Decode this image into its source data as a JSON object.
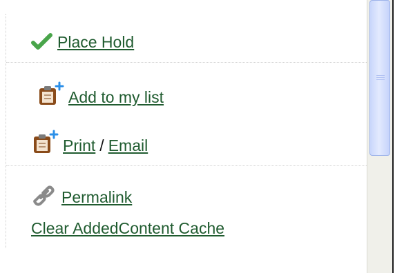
{
  "actions": {
    "place_hold": {
      "label": "Place Hold",
      "icon": "checkmark-icon"
    },
    "add_to_list": {
      "label": "Add to my list",
      "icon": "clipboard-add-icon"
    },
    "print": {
      "label": "Print",
      "icon": "clipboard-add-icon"
    },
    "separator": "/",
    "email": {
      "label": "Email"
    },
    "permalink": {
      "label": "Permalink",
      "icon": "link-icon"
    },
    "clear_cache": {
      "label": "Clear AddedContent Cache"
    }
  },
  "colors": {
    "link": "#1f5b2f",
    "check": "#49a54a",
    "clipboard": "#8a4b1a",
    "plus": "#2b8fe8"
  }
}
